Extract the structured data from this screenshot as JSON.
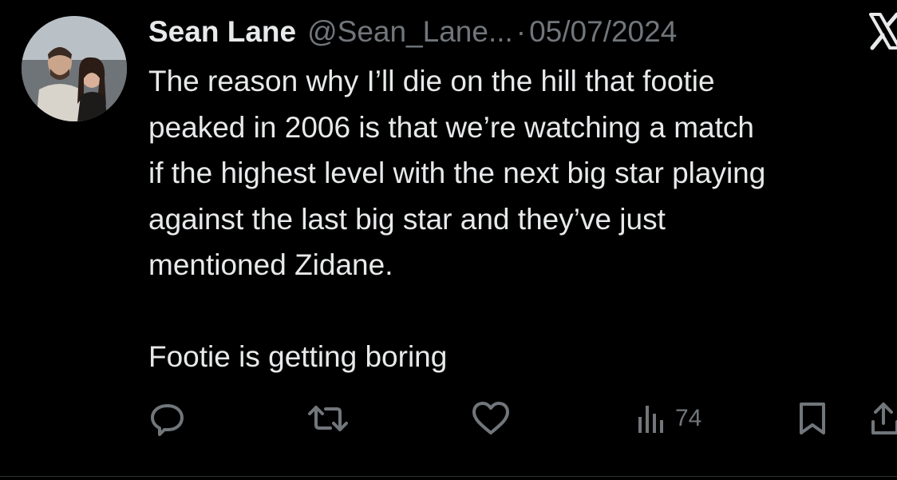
{
  "tweet": {
    "author_name": "Sean Lane",
    "handle": "@Sean_Lane...",
    "separator": "·",
    "date": "05/07/2024",
    "lines": [
      "The reason why I’ll die on the hill that footie",
      "peaked in 2006 is that we’re watching a match",
      "if the highest level with the next big star playing",
      "against the last big star and they’ve just",
      "mentioned Zidane.",
      "",
      "Footie is getting boring"
    ]
  },
  "actions": {
    "views_count": "74"
  },
  "icons": {
    "brand": "x-logo-icon",
    "reply": "reply-icon",
    "repost": "repost-icon",
    "like": "heart-icon",
    "views": "views-bar-chart-icon",
    "bookmark": "bookmark-icon",
    "share": "share-icon"
  },
  "colors": {
    "background": "#000000",
    "primary_text": "#e7e9ea",
    "secondary_text": "#71767b"
  }
}
